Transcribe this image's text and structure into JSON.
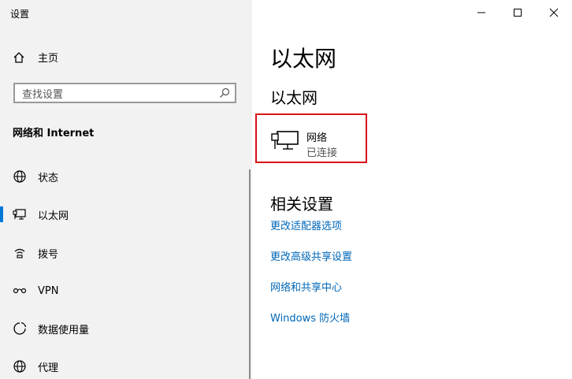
{
  "window": {
    "title": "设置",
    "controls": {
      "minimize": "minimize-icon",
      "maximize": "maximize-icon",
      "close": "close-icon"
    }
  },
  "sidebar": {
    "home_label": "主页",
    "search_placeholder": "查找设置",
    "section_title": "网络和 Internet",
    "items": [
      {
        "label": "状态",
        "icon": "globe-icon"
      },
      {
        "label": "以太网",
        "icon": "ethernet-icon",
        "active": true
      },
      {
        "label": "拨号",
        "icon": "dialup-icon"
      },
      {
        "label": "VPN",
        "icon": "vpn-icon"
      },
      {
        "label": "数据使用量",
        "icon": "data-usage-icon"
      },
      {
        "label": "代理",
        "icon": "proxy-globe-icon"
      }
    ]
  },
  "main": {
    "page_title": "以太网",
    "sub_title": "以太网",
    "network": {
      "name": "网络",
      "status": "已连接"
    },
    "related_title": "相关设置",
    "links": [
      "更改适配器选项",
      "更改高级共享设置",
      "网络和共享中心",
      "Windows 防火墙"
    ]
  },
  "colors": {
    "accent": "#0078d7",
    "link": "#0067b8",
    "highlight_border": "#d9111a",
    "sidebar_bg": "#f2f2f2"
  }
}
